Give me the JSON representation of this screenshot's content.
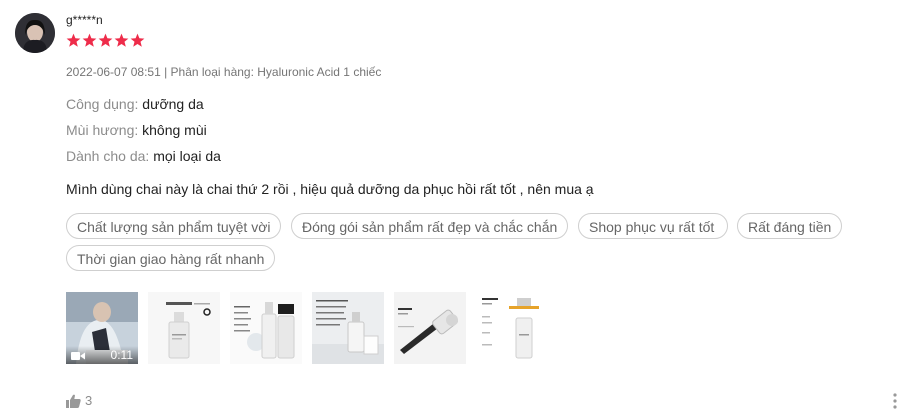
{
  "review": {
    "username": "g*****n",
    "rating": 5,
    "star_color": "#ee2c4a",
    "meta": "2022-06-07 08:51 | Phân loại hàng: Hyaluronic Acid 1 chiếc",
    "attributes": [
      {
        "key": "Công dụng:",
        "value": "dưỡng da"
      },
      {
        "key": "Mùi hương:",
        "value": "không mùi"
      },
      {
        "key": "Dành cho da:",
        "value": "mọi loại da"
      }
    ],
    "text": "Mình dùng chai này là chai thứ 2 rồi , hiệu quả dưỡng da phục hồi rất tốt , nên mua ạ",
    "tags": [
      "Chất lượng sản phẩm tuyệt vời",
      "Đóng gói sản phẩm rất đẹp và chắc chắn",
      "Shop phục vụ rất tốt",
      "Rất đáng tiền",
      "Thời gian giao hàng rất nhanh"
    ],
    "video": {
      "duration": "0:11"
    },
    "media_icons": [
      "video-thumbnail",
      "product-photo",
      "product-photo",
      "product-photo",
      "product-photo",
      "product-photo"
    ],
    "likes": "3"
  }
}
